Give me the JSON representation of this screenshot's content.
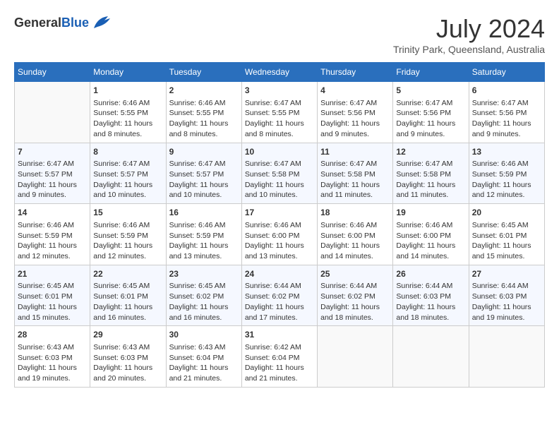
{
  "header": {
    "logo_general": "General",
    "logo_blue": "Blue",
    "month": "July 2024",
    "location": "Trinity Park, Queensland, Australia"
  },
  "weekdays": [
    "Sunday",
    "Monday",
    "Tuesday",
    "Wednesday",
    "Thursday",
    "Friday",
    "Saturday"
  ],
  "weeks": [
    [
      {
        "day": "",
        "info": ""
      },
      {
        "day": "1",
        "info": "Sunrise: 6:46 AM\nSunset: 5:55 PM\nDaylight: 11 hours\nand 8 minutes."
      },
      {
        "day": "2",
        "info": "Sunrise: 6:46 AM\nSunset: 5:55 PM\nDaylight: 11 hours\nand 8 minutes."
      },
      {
        "day": "3",
        "info": "Sunrise: 6:47 AM\nSunset: 5:55 PM\nDaylight: 11 hours\nand 8 minutes."
      },
      {
        "day": "4",
        "info": "Sunrise: 6:47 AM\nSunset: 5:56 PM\nDaylight: 11 hours\nand 9 minutes."
      },
      {
        "day": "5",
        "info": "Sunrise: 6:47 AM\nSunset: 5:56 PM\nDaylight: 11 hours\nand 9 minutes."
      },
      {
        "day": "6",
        "info": "Sunrise: 6:47 AM\nSunset: 5:56 PM\nDaylight: 11 hours\nand 9 minutes."
      }
    ],
    [
      {
        "day": "7",
        "info": "Sunrise: 6:47 AM\nSunset: 5:57 PM\nDaylight: 11 hours\nand 9 minutes."
      },
      {
        "day": "8",
        "info": "Sunrise: 6:47 AM\nSunset: 5:57 PM\nDaylight: 11 hours\nand 10 minutes."
      },
      {
        "day": "9",
        "info": "Sunrise: 6:47 AM\nSunset: 5:57 PM\nDaylight: 11 hours\nand 10 minutes."
      },
      {
        "day": "10",
        "info": "Sunrise: 6:47 AM\nSunset: 5:58 PM\nDaylight: 11 hours\nand 10 minutes."
      },
      {
        "day": "11",
        "info": "Sunrise: 6:47 AM\nSunset: 5:58 PM\nDaylight: 11 hours\nand 11 minutes."
      },
      {
        "day": "12",
        "info": "Sunrise: 6:47 AM\nSunset: 5:58 PM\nDaylight: 11 hours\nand 11 minutes."
      },
      {
        "day": "13",
        "info": "Sunrise: 6:46 AM\nSunset: 5:59 PM\nDaylight: 11 hours\nand 12 minutes."
      }
    ],
    [
      {
        "day": "14",
        "info": "Sunrise: 6:46 AM\nSunset: 5:59 PM\nDaylight: 11 hours\nand 12 minutes."
      },
      {
        "day": "15",
        "info": "Sunrise: 6:46 AM\nSunset: 5:59 PM\nDaylight: 11 hours\nand 12 minutes."
      },
      {
        "day": "16",
        "info": "Sunrise: 6:46 AM\nSunset: 5:59 PM\nDaylight: 11 hours\nand 13 minutes."
      },
      {
        "day": "17",
        "info": "Sunrise: 6:46 AM\nSunset: 6:00 PM\nDaylight: 11 hours\nand 13 minutes."
      },
      {
        "day": "18",
        "info": "Sunrise: 6:46 AM\nSunset: 6:00 PM\nDaylight: 11 hours\nand 14 minutes."
      },
      {
        "day": "19",
        "info": "Sunrise: 6:46 AM\nSunset: 6:00 PM\nDaylight: 11 hours\nand 14 minutes."
      },
      {
        "day": "20",
        "info": "Sunrise: 6:45 AM\nSunset: 6:01 PM\nDaylight: 11 hours\nand 15 minutes."
      }
    ],
    [
      {
        "day": "21",
        "info": "Sunrise: 6:45 AM\nSunset: 6:01 PM\nDaylight: 11 hours\nand 15 minutes."
      },
      {
        "day": "22",
        "info": "Sunrise: 6:45 AM\nSunset: 6:01 PM\nDaylight: 11 hours\nand 16 minutes."
      },
      {
        "day": "23",
        "info": "Sunrise: 6:45 AM\nSunset: 6:02 PM\nDaylight: 11 hours\nand 16 minutes."
      },
      {
        "day": "24",
        "info": "Sunrise: 6:44 AM\nSunset: 6:02 PM\nDaylight: 11 hours\nand 17 minutes."
      },
      {
        "day": "25",
        "info": "Sunrise: 6:44 AM\nSunset: 6:02 PM\nDaylight: 11 hours\nand 18 minutes."
      },
      {
        "day": "26",
        "info": "Sunrise: 6:44 AM\nSunset: 6:03 PM\nDaylight: 11 hours\nand 18 minutes."
      },
      {
        "day": "27",
        "info": "Sunrise: 6:44 AM\nSunset: 6:03 PM\nDaylight: 11 hours\nand 19 minutes."
      }
    ],
    [
      {
        "day": "28",
        "info": "Sunrise: 6:43 AM\nSunset: 6:03 PM\nDaylight: 11 hours\nand 19 minutes."
      },
      {
        "day": "29",
        "info": "Sunrise: 6:43 AM\nSunset: 6:03 PM\nDaylight: 11 hours\nand 20 minutes."
      },
      {
        "day": "30",
        "info": "Sunrise: 6:43 AM\nSunset: 6:04 PM\nDaylight: 11 hours\nand 21 minutes."
      },
      {
        "day": "31",
        "info": "Sunrise: 6:42 AM\nSunset: 6:04 PM\nDaylight: 11 hours\nand 21 minutes."
      },
      {
        "day": "",
        "info": ""
      },
      {
        "day": "",
        "info": ""
      },
      {
        "day": "",
        "info": ""
      }
    ]
  ]
}
